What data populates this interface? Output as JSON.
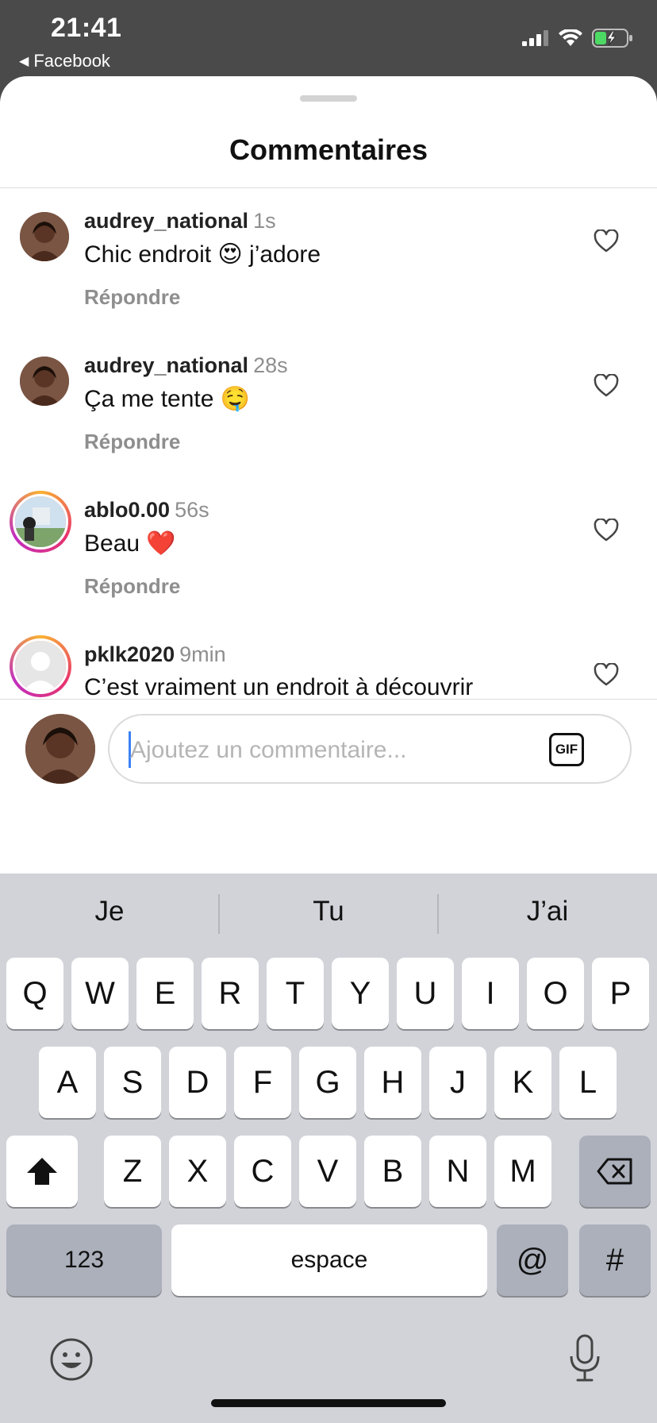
{
  "status_bar": {
    "time": "21:41",
    "back_app": "Facebook",
    "icons": [
      "signal-icon",
      "wifi-icon",
      "battery-charging-icon"
    ]
  },
  "sheet": {
    "title": "Commentaires",
    "comments": [
      {
        "username": "audrey_national",
        "time": "1s",
        "text": "Chic endroit 😍 j’adore",
        "reply_label": "Répondre",
        "avatar": "woman-avatar"
      },
      {
        "username": "audrey_national",
        "time": "28s",
        "text": "Ça me tente 🤤",
        "reply_label": "Répondre",
        "avatar": "woman-avatar"
      },
      {
        "username": "ablo0.00",
        "time": "56s",
        "text": "Beau ❤️",
        "reply_label": "Répondre",
        "avatar": "photo-avatar"
      },
      {
        "username": "pklk2020",
        "time": "9min",
        "text": "C’est vraiment un endroit à découvrir",
        "reply_label": "",
        "avatar": "default-avatar"
      }
    ],
    "reactions": [
      "❤️",
      "🙌",
      "🔥",
      "👏",
      "😢",
      "😍",
      "😮",
      "😂"
    ],
    "composer": {
      "placeholder": "Ajoutez un commentaire...",
      "gif_label": "GIF"
    }
  },
  "keyboard": {
    "suggestions": [
      "Je",
      "Tu",
      "J’ai"
    ],
    "row1": [
      "Q",
      "W",
      "E",
      "R",
      "T",
      "Y",
      "U",
      "I",
      "O",
      "P"
    ],
    "row2": [
      "A",
      "S",
      "D",
      "F",
      "G",
      "H",
      "J",
      "K",
      "L"
    ],
    "row3": [
      "Z",
      "X",
      "C",
      "V",
      "B",
      "N",
      "M"
    ],
    "numbers_label": "123",
    "space_label": "espace",
    "at_label": "@",
    "hash_label": "#"
  },
  "colors": {
    "status_bar_bg": "#4a4a4a",
    "keyboard_bg": "#d1d3d9",
    "secondary_text": "#8e8e8e",
    "caret": "#3b82f6",
    "battery_green": "#4cd964"
  }
}
